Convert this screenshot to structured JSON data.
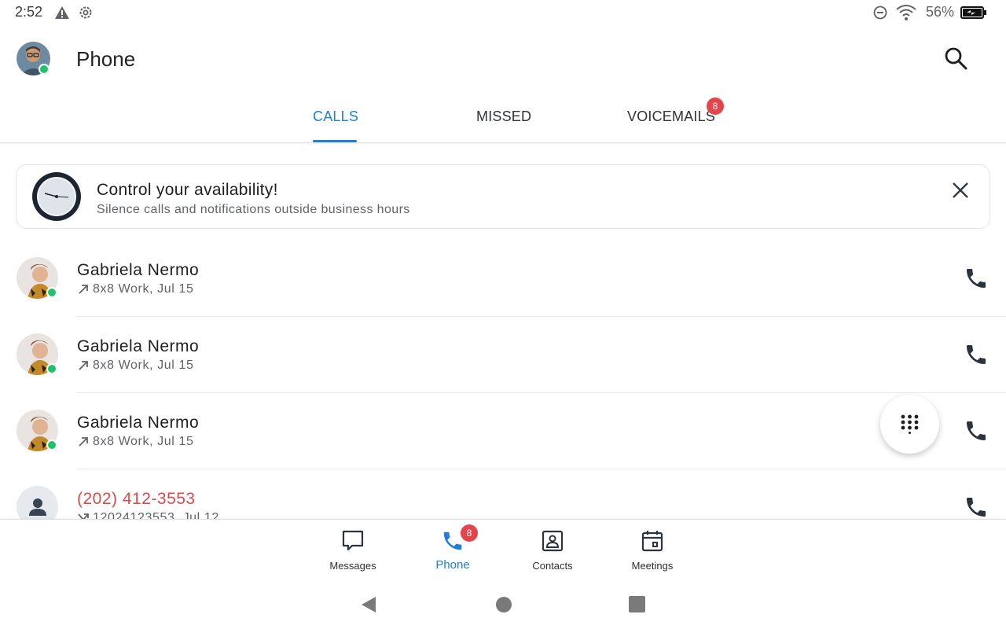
{
  "status_bar": {
    "time": "2:52",
    "battery_percent": "56%",
    "icons": [
      "warning-icon",
      "settings-icon",
      "do-not-disturb-icon",
      "wifi-icon",
      "battery-charging-icon"
    ]
  },
  "header": {
    "title": "Phone",
    "avatar": "user-avatar",
    "presence": "online",
    "search_icon": "search-icon"
  },
  "tabs": [
    {
      "label": "CALLS",
      "active": true
    },
    {
      "label": "MISSED",
      "active": false
    },
    {
      "label": "VOICEMAILS",
      "active": false,
      "badge": "8"
    }
  ],
  "banner": {
    "icon": "clock-icon",
    "title": "Control your availability!",
    "subtitle": "Silence calls and notifications outside business hours",
    "close_icon": "close-icon"
  },
  "calls": [
    {
      "name": "Gabriela Nermo",
      "detail": "8x8 Work, Jul 15",
      "direction": "outgoing",
      "online": true,
      "missed": false
    },
    {
      "name": "Gabriela Nermo",
      "detail": "8x8 Work, Jul 15",
      "direction": "outgoing",
      "online": true,
      "missed": false
    },
    {
      "name": "Gabriela Nermo",
      "detail": "8x8 Work, Jul 15",
      "direction": "outgoing",
      "online": true,
      "missed": false
    },
    {
      "name": "(202) 412-3553",
      "detail": "12024123553, Jul 12",
      "direction": "missed",
      "online": false,
      "missed": true
    }
  ],
  "fab": {
    "icon": "dialpad-icon"
  },
  "bottom_nav": [
    {
      "label": "Messages",
      "icon": "message-icon",
      "active": false
    },
    {
      "label": "Phone",
      "icon": "phone-icon",
      "active": true,
      "badge": "8"
    },
    {
      "label": "Contacts",
      "icon": "contacts-icon",
      "active": false
    },
    {
      "label": "Meetings",
      "icon": "calendar-icon",
      "active": false
    }
  ],
  "colors": {
    "accent": "#1f7fd6",
    "badge": "#e5454a",
    "presence": "#1ec26a",
    "missed_text": "#e04848"
  }
}
